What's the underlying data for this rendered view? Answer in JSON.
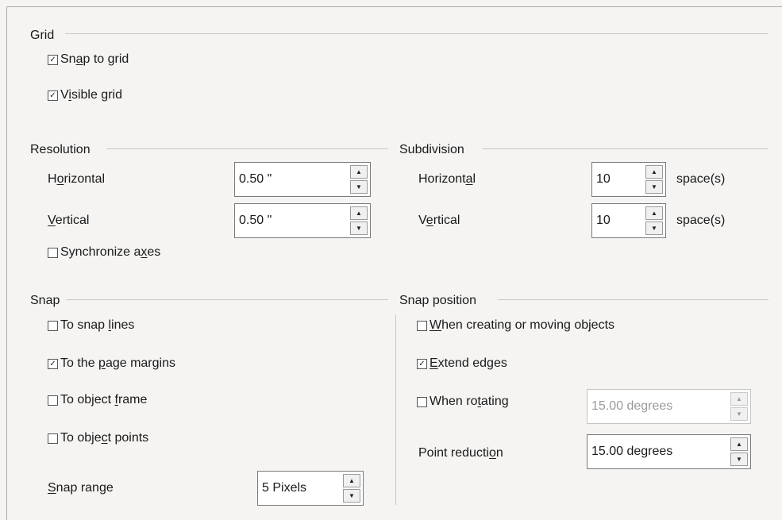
{
  "grid": {
    "title": "Grid",
    "snap_to_grid": {
      "pre": "Sn",
      "key": "a",
      "post": "p to grid",
      "checked": true
    },
    "visible_grid": {
      "pre": "V",
      "key": "i",
      "post": "sible grid",
      "checked": true
    }
  },
  "resolution": {
    "title": "Resolution",
    "horizontal": {
      "pre": "H",
      "key": "o",
      "post": "rizontal",
      "value": "0.50 \""
    },
    "vertical": {
      "pre": "",
      "key": "V",
      "post": "ertical",
      "value": "0.50 \""
    },
    "synchronize": {
      "pre": "Synchronize a",
      "key": "x",
      "post": "es",
      "checked": false
    }
  },
  "subdivision": {
    "title": "Subdivision",
    "horizontal": {
      "pre": "Horizont",
      "key": "a",
      "post": "l",
      "value": "10",
      "unit": "space(s)"
    },
    "vertical": {
      "pre": "V",
      "key": "e",
      "post": "rtical",
      "value": "10",
      "unit": "space(s)"
    }
  },
  "snap": {
    "title": "Snap",
    "snap_lines": {
      "pre": "To snap ",
      "key": "l",
      "post": "ines",
      "checked": false
    },
    "page_margins": {
      "pre": "To the ",
      "key": "p",
      "post": "age margins",
      "checked": true
    },
    "object_frame": {
      "pre": "To object ",
      "key": "f",
      "post": "rame",
      "checked": false
    },
    "object_points": {
      "pre": "To obje",
      "key": "c",
      "post": "t points",
      "checked": false
    },
    "range": {
      "pre": "",
      "key": "S",
      "post": "nap range",
      "value": "5 Pixels"
    }
  },
  "snap_position": {
    "title": "Snap position",
    "creating": {
      "pre": "",
      "key": "W",
      "post": "hen creating or moving objects",
      "checked": false
    },
    "extend": {
      "pre": "",
      "key": "E",
      "post": "xtend edges",
      "checked": true
    },
    "rotating": {
      "pre": "When ro",
      "key": "t",
      "post": "ating",
      "checked": false,
      "value": "15.00 degrees"
    },
    "point_reduction": {
      "pre": "Point reducti",
      "key": "o",
      "post": "n",
      "value": "15.00 degrees"
    }
  },
  "glyphs": {
    "checked": "☑",
    "unchecked": "☐",
    "up": "▲",
    "down": "▼"
  }
}
